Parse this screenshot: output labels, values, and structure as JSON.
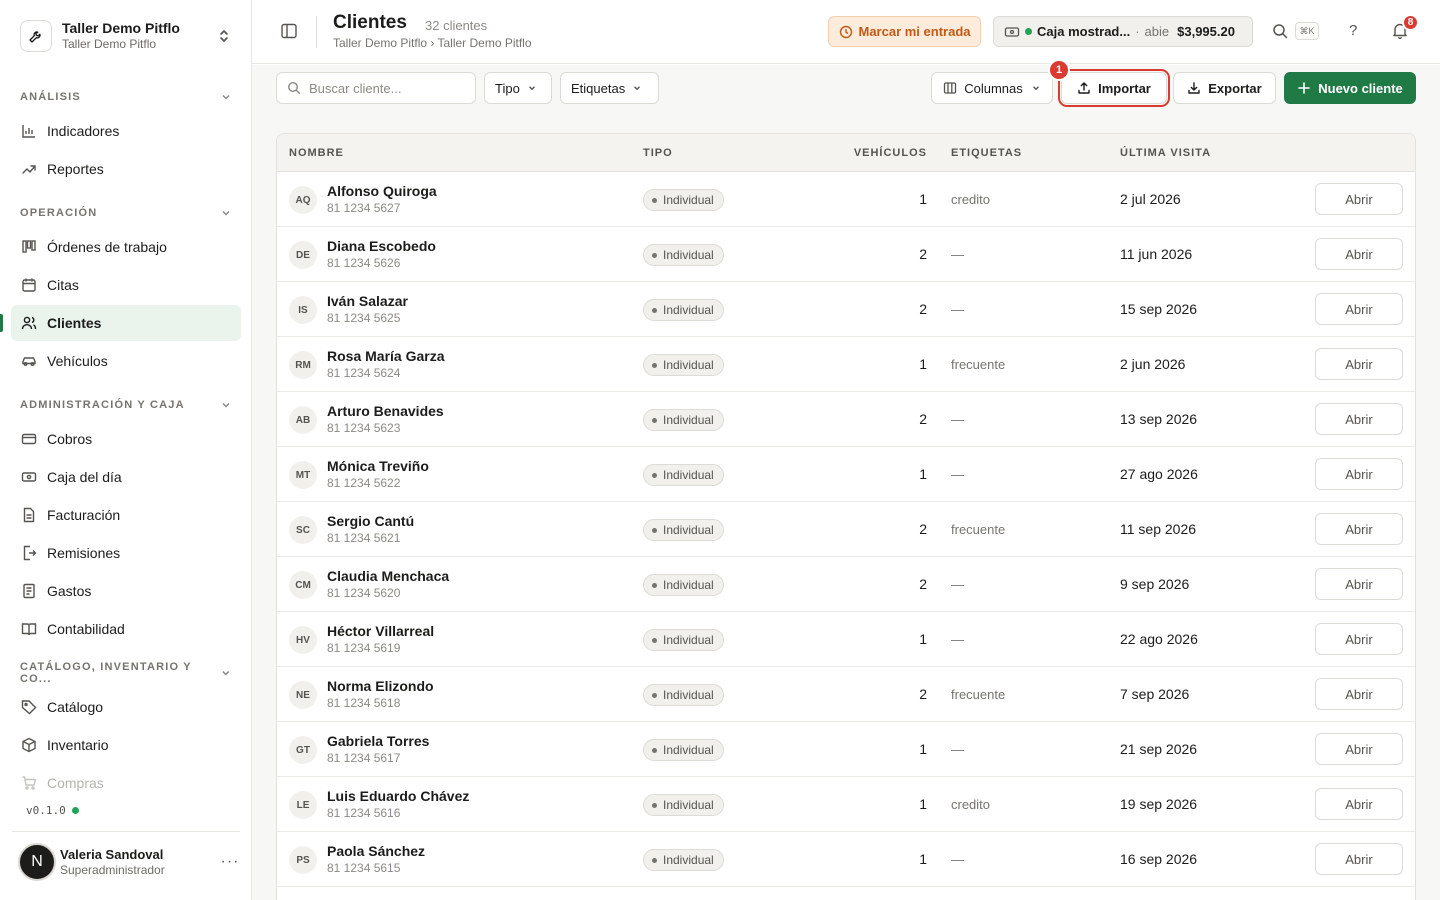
{
  "workspace": {
    "name": "Taller Demo Pitflo",
    "subtitle": "Taller Demo Pitflo"
  },
  "sidebar": {
    "sections": [
      {
        "label": "ANÁLISIS",
        "items": [
          {
            "label": "Indicadores",
            "icon": "bar-chart-icon"
          },
          {
            "label": "Reportes",
            "icon": "trend-up-icon"
          }
        ]
      },
      {
        "label": "OPERACIÓN",
        "items": [
          {
            "label": "Órdenes de trabajo",
            "icon": "kanban-icon"
          },
          {
            "label": "Citas",
            "icon": "calendar-icon"
          },
          {
            "label": "Clientes",
            "icon": "users-icon",
            "active": true
          },
          {
            "label": "Vehículos",
            "icon": "car-icon"
          }
        ]
      },
      {
        "label": "ADMINISTRACIÓN Y CAJA",
        "items": [
          {
            "label": "Cobros",
            "icon": "credit-card-icon"
          },
          {
            "label": "Caja del día",
            "icon": "cash-register-icon"
          },
          {
            "label": "Facturación",
            "icon": "invoice-icon"
          },
          {
            "label": "Remisiones",
            "icon": "remission-icon"
          },
          {
            "label": "Gastos",
            "icon": "receipt-icon"
          },
          {
            "label": "Contabilidad",
            "icon": "book-icon"
          }
        ]
      },
      {
        "label": "CATÁLOGO, INVENTARIO Y CO...",
        "items": [
          {
            "label": "Catálogo",
            "icon": "tag-icon"
          },
          {
            "label": "Inventario",
            "icon": "box-icon"
          },
          {
            "label": "Compras",
            "icon": "cart-icon"
          }
        ]
      }
    ],
    "version": "v0.1.0",
    "user": {
      "initial": "N",
      "name": "Valeria Sandoval",
      "role": "Superadministrador",
      "more": "···"
    }
  },
  "topbar": {
    "title": "Clientes",
    "count": "32 clientes",
    "breadcrumb": "Taller Demo Pitflo › Taller Demo Pitflo",
    "clock_in": "Marcar mi entrada",
    "cash": {
      "name": "Caja mostrad...",
      "separator": "·",
      "state": "abie",
      "amount": "$3,995.20"
    },
    "shortcut": "⌘K",
    "help": "?",
    "notifications": "8"
  },
  "toolbar": {
    "search_placeholder": "Buscar cliente...",
    "filter_type": "Tipo",
    "filter_tags": "Etiquetas",
    "columns": "Columnas",
    "import": "Importar",
    "import_step": "1",
    "export": "Exportar",
    "new_client": "Nuevo cliente"
  },
  "table": {
    "headers": {
      "name": "NOMBRE",
      "type": "TIPO",
      "vehicles": "VEHÍCULOS",
      "tags": "ETIQUETAS",
      "last_visit": "ÚLTIMA VISITA"
    },
    "open_label": "Abrir",
    "rows": [
      {
        "initials": "AQ",
        "name": "Alfonso Quiroga",
        "phone": "81 1234 5627",
        "type": "Individual",
        "vehicles": "1",
        "tags": "credito",
        "last_visit": "2 jul 2026"
      },
      {
        "initials": "DE",
        "name": "Diana Escobedo",
        "phone": "81 1234 5626",
        "type": "Individual",
        "vehicles": "2",
        "tags": "—",
        "last_visit": "11 jun 2026"
      },
      {
        "initials": "IS",
        "name": "Iván Salazar",
        "phone": "81 1234 5625",
        "type": "Individual",
        "vehicles": "2",
        "tags": "—",
        "last_visit": "15 sep 2026"
      },
      {
        "initials": "RM",
        "name": "Rosa María Garza",
        "phone": "81 1234 5624",
        "type": "Individual",
        "vehicles": "1",
        "tags": "frecuente",
        "last_visit": "2 jun 2026"
      },
      {
        "initials": "AB",
        "name": "Arturo Benavides",
        "phone": "81 1234 5623",
        "type": "Individual",
        "vehicles": "2",
        "tags": "—",
        "last_visit": "13 sep 2026"
      },
      {
        "initials": "MT",
        "name": "Mónica Treviño",
        "phone": "81 1234 5622",
        "type": "Individual",
        "vehicles": "1",
        "tags": "—",
        "last_visit": "27 ago 2026"
      },
      {
        "initials": "SC",
        "name": "Sergio Cantú",
        "phone": "81 1234 5621",
        "type": "Individual",
        "vehicles": "2",
        "tags": "frecuente",
        "last_visit": "11 sep 2026"
      },
      {
        "initials": "CM",
        "name": "Claudia Menchaca",
        "phone": "81 1234 5620",
        "type": "Individual",
        "vehicles": "2",
        "tags": "—",
        "last_visit": "9 sep 2026"
      },
      {
        "initials": "HV",
        "name": "Héctor Villarreal",
        "phone": "81 1234 5619",
        "type": "Individual",
        "vehicles": "1",
        "tags": "—",
        "last_visit": "22 ago 2026"
      },
      {
        "initials": "NE",
        "name": "Norma Elizondo",
        "phone": "81 1234 5618",
        "type": "Individual",
        "vehicles": "2",
        "tags": "frecuente",
        "last_visit": "7 sep 2026"
      },
      {
        "initials": "GT",
        "name": "Gabriela Torres",
        "phone": "81 1234 5617",
        "type": "Individual",
        "vehicles": "1",
        "tags": "—",
        "last_visit": "21 sep 2026"
      },
      {
        "initials": "LE",
        "name": "Luis Eduardo Chávez",
        "phone": "81 1234 5616",
        "type": "Individual",
        "vehicles": "1",
        "tags": "credito",
        "last_visit": "19 sep 2026"
      },
      {
        "initials": "PS",
        "name": "Paola Sánchez",
        "phone": "81 1234 5615",
        "type": "Individual",
        "vehicles": "1",
        "tags": "—",
        "last_visit": "16 sep 2026"
      }
    ]
  },
  "colors": {
    "accent": "#1f7a46",
    "danger": "#d93b30",
    "warning": "#c25a16"
  }
}
